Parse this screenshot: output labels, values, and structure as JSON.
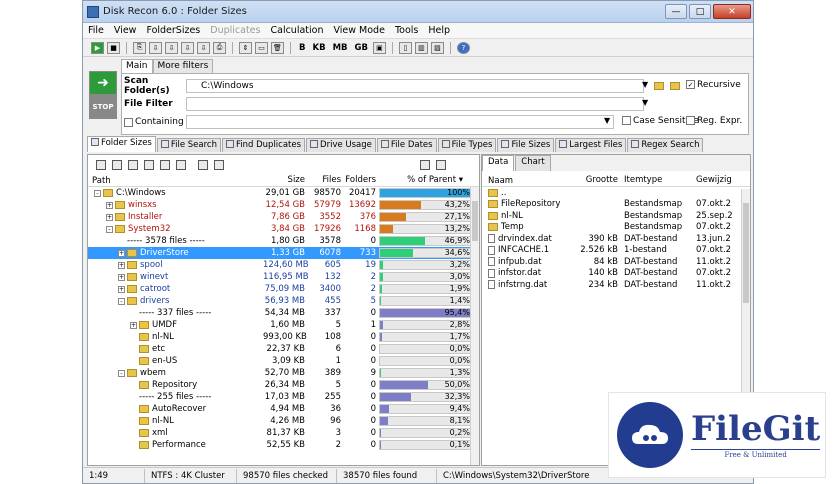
{
  "title": "Disk Recon 6.0 : Folder Sizes",
  "menu": [
    "File",
    "View",
    "FolderSizes",
    "Duplicates",
    "Calculation",
    "View Mode",
    "Tools",
    "Help"
  ],
  "toolbar": {
    "units": [
      "B",
      "KB",
      "MB",
      "GB"
    ]
  },
  "scan": {
    "subtabs": [
      "Main",
      "More filters"
    ],
    "go_label": "➜",
    "stop_label": "STOP",
    "folder_label": "Scan Folder(s)",
    "folder_value": "C:\\Windows",
    "recursive_label": "Recursive",
    "filter_label": "File Filter",
    "containing_label": "Containing",
    "case_label": "Case Sensitive",
    "regex_label": "Reg. Expr."
  },
  "tabs": [
    "Folder Sizes",
    "File Search",
    "Find Duplicates",
    "Drive Usage",
    "File Dates",
    "File Types",
    "File Sizes",
    "Largest Files",
    "Regex Search"
  ],
  "folder_table": {
    "headers": {
      "path": "Path",
      "size": "Size",
      "files": "Files",
      "folders": "Folders",
      "pct": "% of Parent"
    },
    "rows": [
      {
        "name": "C:\\Windows",
        "size": "29,01 GB",
        "files": "98570",
        "folders": "20417",
        "pct": "100%",
        "level": 0,
        "color": "",
        "bar": "#2fa2e0",
        "exp": "-",
        "folder": true
      },
      {
        "name": "winsxs",
        "size": "12,54 GB",
        "files": "57979",
        "folders": "13692",
        "pct": "43,2%",
        "level": 1,
        "color": "red",
        "bar": "#d87a1e",
        "exp": "+",
        "folder": true
      },
      {
        "name": "Installer",
        "size": "7,86 GB",
        "files": "3552",
        "folders": "376",
        "pct": "27,1%",
        "level": 1,
        "color": "red",
        "bar": "#d87a1e",
        "exp": "+",
        "folder": true
      },
      {
        "name": "System32",
        "size": "3,84 GB",
        "files": "17926",
        "folders": "1168",
        "pct": "13,2%",
        "level": 1,
        "color": "red",
        "bar": "#d87a1e",
        "exp": "-",
        "folder": true
      },
      {
        "name": "----- 3578 files -----",
        "size": "1,80 GB",
        "files": "3578",
        "folders": "0",
        "pct": "46,9%",
        "level": 2,
        "color": "",
        "bar": "#2fcf7a",
        "exp": "",
        "folder": false
      },
      {
        "name": "DriverStore",
        "size": "1,33 GB",
        "files": "6078",
        "folders": "733",
        "pct": "34,6%",
        "level": 2,
        "color": "",
        "bar": "#2fcf7a",
        "exp": "+",
        "folder": true,
        "sel": true
      },
      {
        "name": "spool",
        "size": "124,60 MB",
        "files": "605",
        "folders": "19",
        "pct": "3,2%",
        "level": 2,
        "color": "blue",
        "bar": "#2fcf7a",
        "exp": "+",
        "folder": true
      },
      {
        "name": "winevt",
        "size": "116,95 MB",
        "files": "132",
        "folders": "2",
        "pct": "3,0%",
        "level": 2,
        "color": "blue",
        "bar": "#2fcf7a",
        "exp": "+",
        "folder": true
      },
      {
        "name": "catroot",
        "size": "75,09 MB",
        "files": "3400",
        "folders": "2",
        "pct": "1,9%",
        "level": 2,
        "color": "blue",
        "bar": "#2fcf7a",
        "exp": "+",
        "folder": true
      },
      {
        "name": "drivers",
        "size": "56,93 MB",
        "files": "455",
        "folders": "5",
        "pct": "1,4%",
        "level": 2,
        "color": "blue",
        "bar": "#2fcf7a",
        "exp": "-",
        "folder": true
      },
      {
        "name": "----- 337 files -----",
        "size": "54,34 MB",
        "files": "337",
        "folders": "0",
        "pct": "95,4%",
        "level": 3,
        "color": "",
        "bar": "#7e7ec8",
        "exp": "",
        "folder": false
      },
      {
        "name": "UMDF",
        "size": "1,60 MB",
        "files": "5",
        "folders": "1",
        "pct": "2,8%",
        "level": 3,
        "color": "",
        "bar": "#7e7ec8",
        "exp": "+",
        "folder": true
      },
      {
        "name": "nl-NL",
        "size": "993,00 KB",
        "files": "108",
        "folders": "0",
        "pct": "1,7%",
        "level": 3,
        "color": "",
        "bar": "#7e7ec8",
        "exp": "",
        "folder": true
      },
      {
        "name": "etc",
        "size": "22,37 KB",
        "files": "6",
        "folders": "0",
        "pct": "0,0%",
        "level": 3,
        "color": "",
        "bar": "#7e7ec8",
        "exp": "",
        "folder": true
      },
      {
        "name": "en-US",
        "size": "3,09 KB",
        "files": "1",
        "folders": "0",
        "pct": "0,0%",
        "level": 3,
        "color": "",
        "bar": "#7e7ec8",
        "exp": "",
        "folder": true
      },
      {
        "name": "wbem",
        "size": "52,70 MB",
        "files": "389",
        "folders": "9",
        "pct": "1,3%",
        "level": 2,
        "color": "",
        "bar": "#2fcf7a",
        "exp": "-",
        "folder": true
      },
      {
        "name": "Repository",
        "size": "26,34 MB",
        "files": "5",
        "folders": "0",
        "pct": "50,0%",
        "level": 3,
        "color": "",
        "bar": "#7e7ec8",
        "exp": "",
        "folder": true
      },
      {
        "name": "----- 255 files -----",
        "size": "17,03 MB",
        "files": "255",
        "folders": "0",
        "pct": "32,3%",
        "level": 3,
        "color": "",
        "bar": "#7e7ec8",
        "exp": "",
        "folder": false
      },
      {
        "name": "AutoRecover",
        "size": "4,94 MB",
        "files": "36",
        "folders": "0",
        "pct": "9,4%",
        "level": 3,
        "color": "",
        "bar": "#7e7ec8",
        "exp": "",
        "folder": true
      },
      {
        "name": "nl-NL",
        "size": "4,26 MB",
        "files": "96",
        "folders": "0",
        "pct": "8,1%",
        "level": 3,
        "color": "",
        "bar": "#7e7ec8",
        "exp": "",
        "folder": true
      },
      {
        "name": "xml",
        "size": "81,37 KB",
        "files": "3",
        "folders": "0",
        "pct": "0,2%",
        "level": 3,
        "color": "",
        "bar": "#7e7ec8",
        "exp": "",
        "folder": true
      },
      {
        "name": "Performance",
        "size": "52,55 KB",
        "files": "2",
        "folders": "0",
        "pct": "0,1%",
        "level": 3,
        "color": "",
        "bar": "#7e7ec8",
        "exp": "",
        "folder": true
      }
    ]
  },
  "right_panel": {
    "tabs": [
      "Data",
      "Chart"
    ],
    "headers": {
      "name": "Naam",
      "size": "Grootte",
      "type": "Itemtype",
      "date": "Gewijzig"
    },
    "rows": [
      {
        "name": "..",
        "size": "",
        "type": "",
        "date": "",
        "folder": true
      },
      {
        "name": "FileRepository",
        "size": "",
        "type": "Bestandsmap",
        "date": "07.okt.2",
        "folder": true
      },
      {
        "name": "nl-NL",
        "size": "",
        "type": "Bestandsmap",
        "date": "25.sep.2",
        "folder": true
      },
      {
        "name": "Temp",
        "size": "",
        "type": "Bestandsmap",
        "date": "07.okt.2",
        "folder": true
      },
      {
        "name": "drvindex.dat",
        "size": "390 kB",
        "type": "DAT-bestand",
        "date": "13.jun.2",
        "folder": false
      },
      {
        "name": "INFCACHE.1",
        "size": "2.526 kB",
        "type": "1-bestand",
        "date": "07.okt.2",
        "folder": false
      },
      {
        "name": "infpub.dat",
        "size": "84 kB",
        "type": "DAT-bestand",
        "date": "11.okt.2",
        "folder": false
      },
      {
        "name": "infstor.dat",
        "size": "140 kB",
        "type": "DAT-bestand",
        "date": "07.okt.2",
        "folder": false
      },
      {
        "name": "infstrng.dat",
        "size": "234 kB",
        "type": "DAT-bestand",
        "date": "11.okt.2",
        "folder": false
      }
    ]
  },
  "status": [
    "1:49",
    "NTFS : 4K Cluster",
    "98570 files checked",
    "38570 files found",
    "C:\\Windows\\System32\\DriverStore"
  ],
  "logo": {
    "name": "FileGit",
    "tagline": "Free & Unlimited"
  }
}
